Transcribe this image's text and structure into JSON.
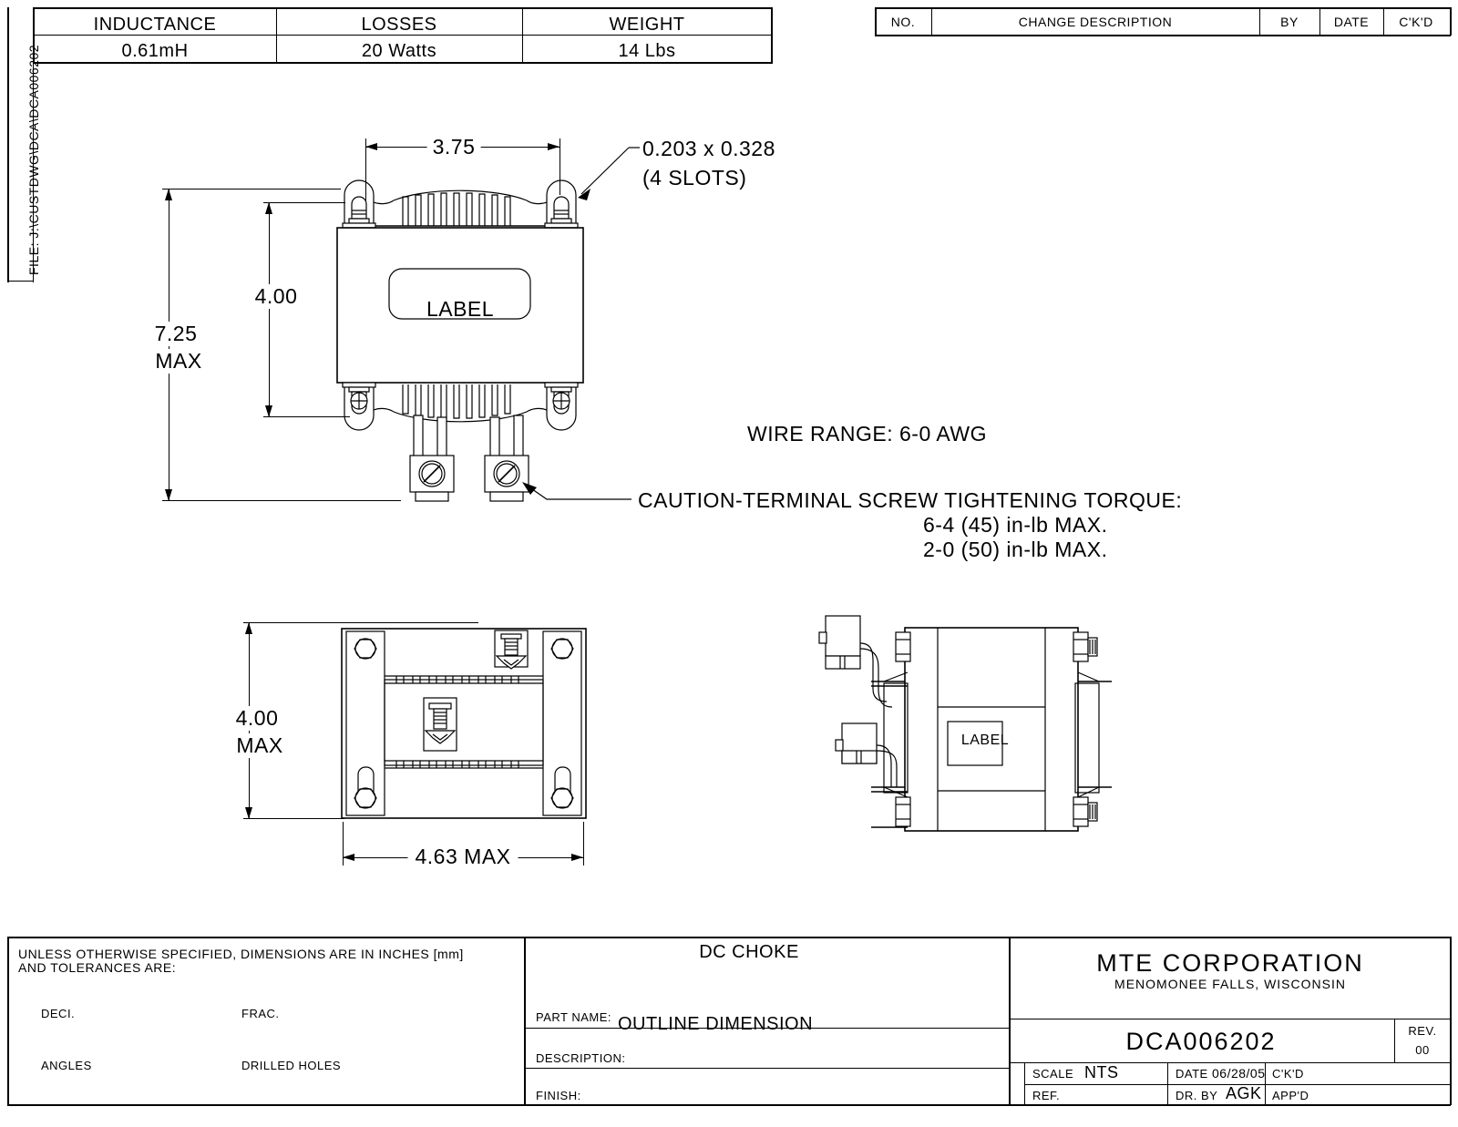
{
  "sheet": {
    "file_label": "FILE: J:\\CUSTDWG\\DCA\\DCA006202"
  },
  "spec_table": {
    "headers": [
      "INDUCTANCE",
      "LOSSES",
      "WEIGHT"
    ],
    "values": [
      "0.61mH",
      "20 Watts",
      "14 Lbs"
    ]
  },
  "revision_table": {
    "headers": [
      "NO.",
      "CHANGE DESCRIPTION",
      "BY",
      "DATE",
      "C'K'D"
    ],
    "rows": []
  },
  "front_view": {
    "dim_width": "3.75",
    "dim_body_height": "4.00",
    "dim_overall_height": "7.25",
    "dim_overall_height_note": "MAX",
    "label_text": "LABEL",
    "slot_callout_line1": "0.203 x 0.328",
    "slot_callout_line2": "(4 SLOTS)"
  },
  "notes": {
    "wire_range": "WIRE RANGE: 6-0 AWG",
    "caution_line1": "CAUTION-TERMINAL SCREW TIGHTENING TORQUE:",
    "caution_line2": "6-4 (45) in-lb MAX.",
    "caution_line3": "2-0 (50) in-lb MAX."
  },
  "bottom_view": {
    "dim_height": "4.00",
    "dim_height_note": "MAX",
    "dim_width": "4.63  MAX"
  },
  "side_view": {
    "label_text": "LABEL"
  },
  "title_block": {
    "tolerance_line1": "UNLESS OTHERWISE SPECIFIED, DIMENSIONS ARE IN INCHES [mm]",
    "tolerance_line2": "AND TOLERANCES ARE:",
    "deci_label": "DECI.",
    "frac_label": "FRAC.",
    "angles_label": "ANGLES",
    "drilled_holes_label": "DRILLED HOLES",
    "part_name_label": "PART NAME:",
    "part_name_value": "DC CHOKE",
    "description_label": "DESCRIPTION:",
    "description_value": "OUTLINE DIMENSION",
    "finish_label": "FINISH:",
    "company_name": "MTE CORPORATION",
    "company_location": "MENOMONEE FALLS, WISCONSIN",
    "drawing_number": "DCA006202",
    "rev_label": "REV.",
    "rev_value": "00",
    "scale_label": "SCALE",
    "scale_value": "NTS",
    "date_label": "DATE",
    "date_value": "06/28/05",
    "ckd_label": "C'K'D",
    "ref_label": "REF.",
    "drawn_by_label": "DR. BY",
    "drawn_by_value": "AGK",
    "approved_label": "APP'D"
  }
}
